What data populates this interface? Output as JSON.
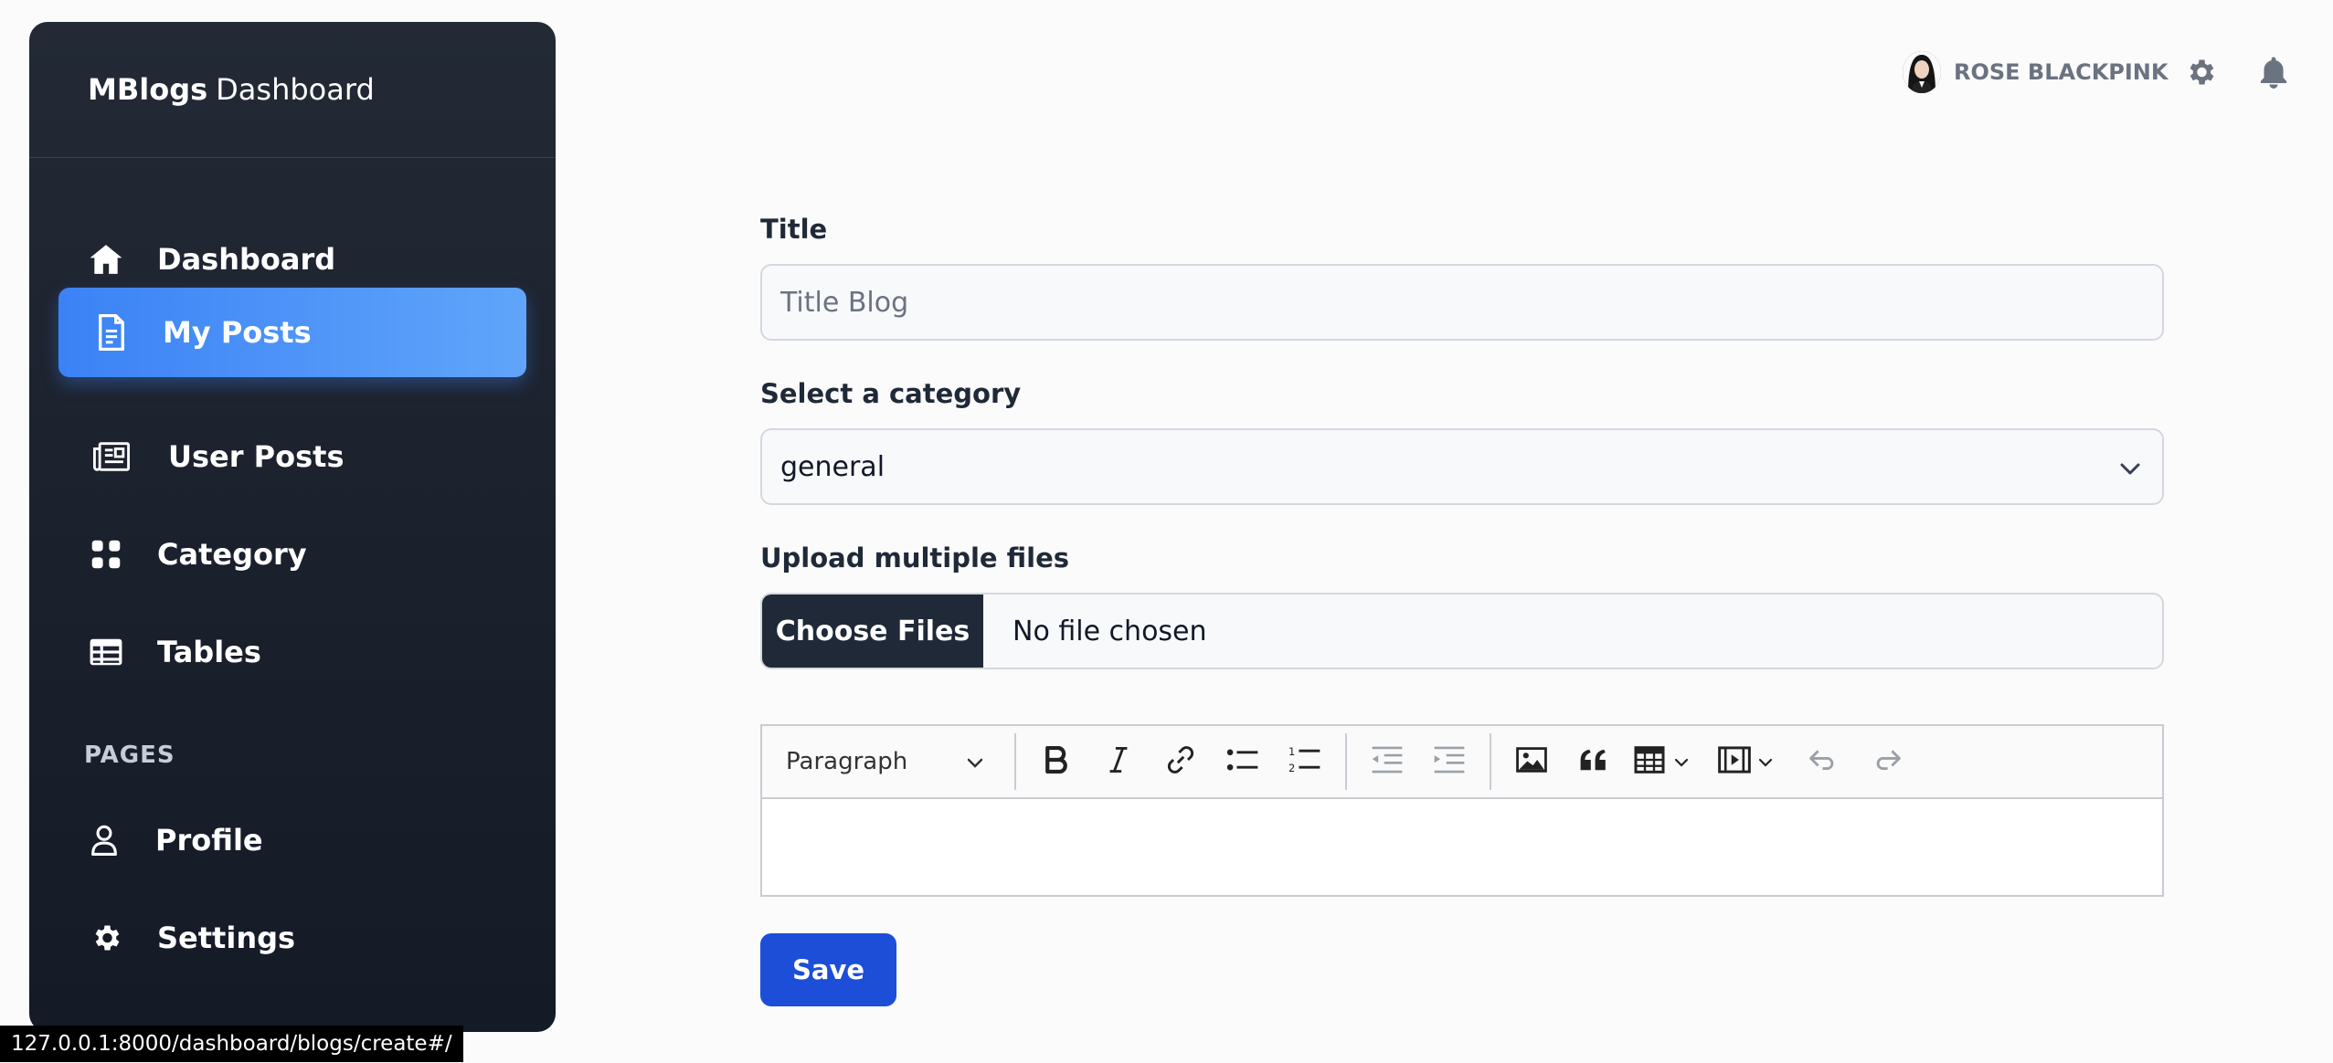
{
  "brand": {
    "bold": "MBlogs",
    "rest": "Dashboard"
  },
  "sidebar": {
    "items": [
      {
        "label": "Dashboard",
        "icon": "home-icon"
      },
      {
        "label": "My Posts",
        "icon": "document-icon",
        "active": true
      },
      {
        "label": "User Posts",
        "icon": "newspaper-icon"
      },
      {
        "label": "Category",
        "icon": "grid-icon"
      },
      {
        "label": "Tables",
        "icon": "table-icon"
      }
    ],
    "pages_title": "PAGES",
    "pages_items": [
      {
        "label": "Profile",
        "icon": "user-icon"
      },
      {
        "label": "Settings",
        "icon": "gear-icon"
      }
    ]
  },
  "header": {
    "user_name": "ROSE BLACKPINK",
    "settings_icon": "gear-icon",
    "notifications_icon": "bell-icon"
  },
  "form": {
    "title_label": "Title",
    "title_placeholder": "Title Blog",
    "title_value": "",
    "category_label": "Select a category",
    "category_value": "general",
    "upload_label": "Upload multiple files",
    "choose_files_label": "Choose Files",
    "no_file_text": "No file chosen",
    "save_label": "Save"
  },
  "editor": {
    "paragraph_label": "Paragraph"
  },
  "status_bar": {
    "url": "127.0.0.1:8000/dashboard/blogs/create#/"
  },
  "colors": {
    "sidebar_bg": "#1a202c",
    "active_item": "#3b82f6",
    "save_button": "#1d4ed8",
    "choose_files_bg": "#1f2937"
  }
}
